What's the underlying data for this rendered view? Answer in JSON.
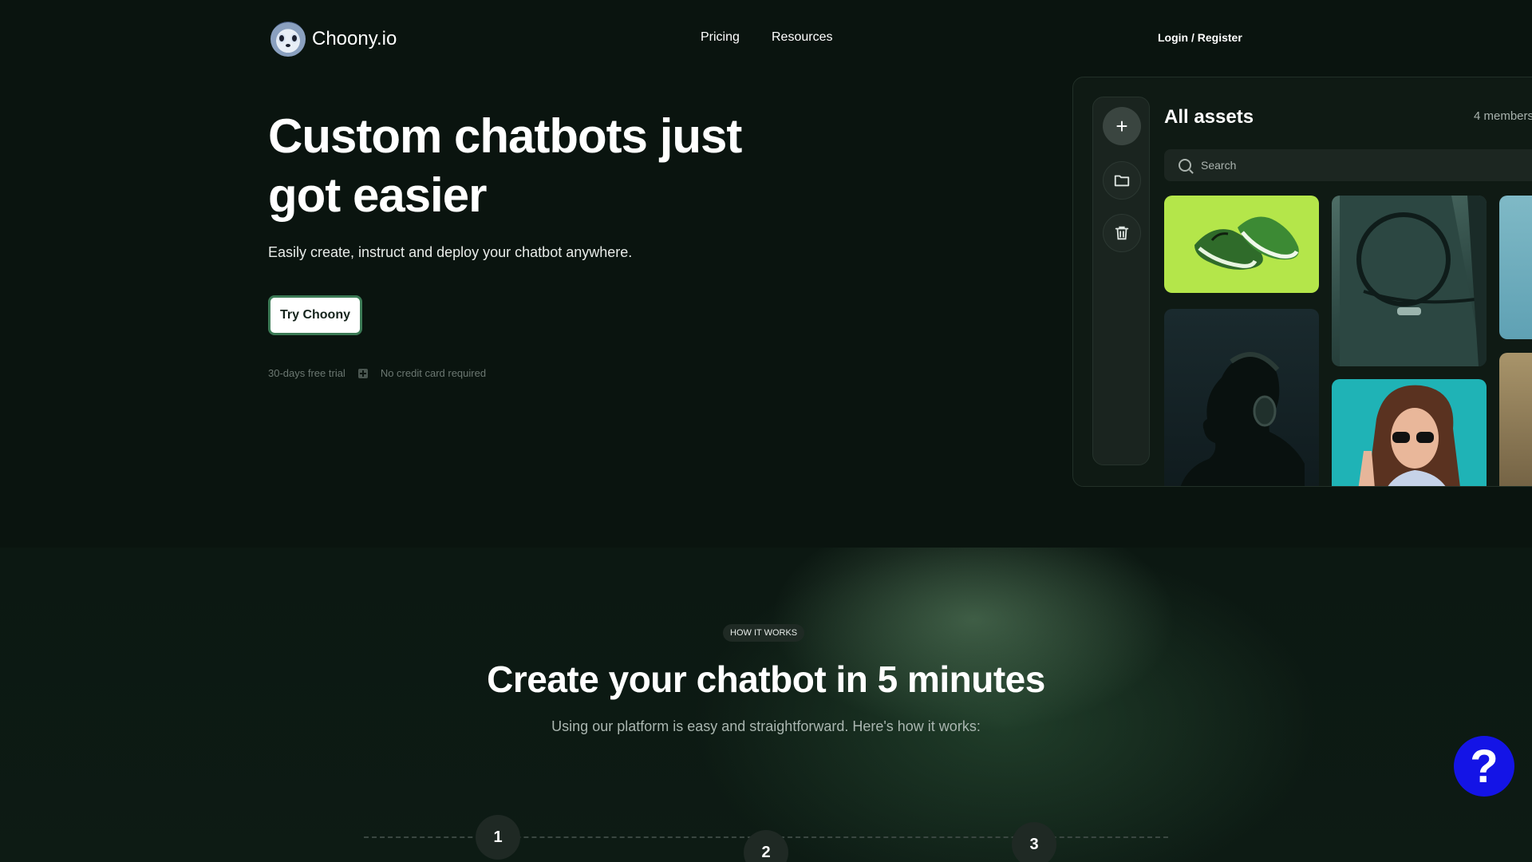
{
  "header": {
    "logo_text": "Choony.io",
    "nav": [
      {
        "label": "Pricing"
      },
      {
        "label": "Resources"
      }
    ],
    "login_label": "Login / Register"
  },
  "hero": {
    "title": "Custom chatbots just got easier",
    "subtitle": "Easily create, instruct and deploy your chatbot anywhere.",
    "cta_label": "Try Choony",
    "meta": {
      "trial": "30-days free trial",
      "card": "No credit card required"
    }
  },
  "preview": {
    "title": "All assets",
    "members": "4 members",
    "search_placeholder": "Search",
    "icons": [
      "plus-icon",
      "folder-icon",
      "trash-icon",
      "search-icon"
    ]
  },
  "how_it_works": {
    "badge": "HOW IT WORKS",
    "title": "Create your chatbot in 5 minutes",
    "subtitle": "Using our platform is easy and straightforward. Here's how it works:",
    "steps": [
      "1",
      "2",
      "3"
    ]
  },
  "help": {
    "label": "?"
  },
  "colors": {
    "background": "#0a140f",
    "cta_border": "#3b7a55",
    "help_button": "#1414e6",
    "shoe_tile": "#b4e64a",
    "woman_tile": "#1fb3b6"
  }
}
